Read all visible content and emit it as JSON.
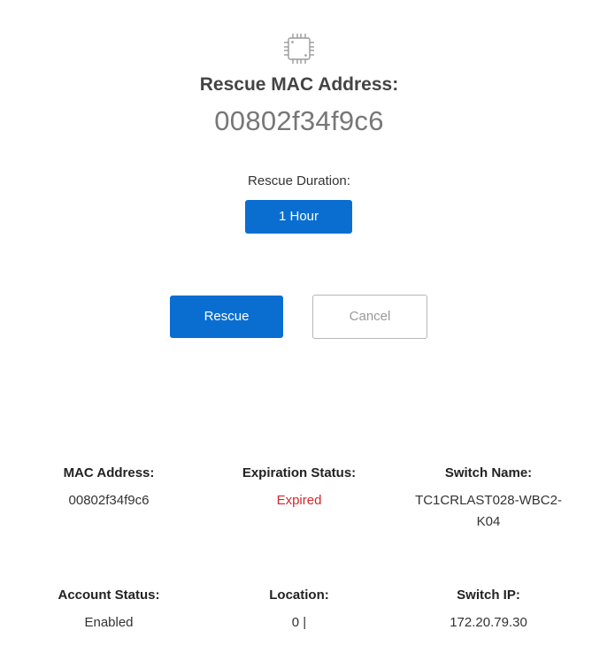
{
  "header": {
    "icon": "chip-icon",
    "title": "Rescue MAC Address:",
    "mac_address": "00802f34f9c6"
  },
  "duration": {
    "label": "Rescue Duration:",
    "selected": "1 Hour"
  },
  "actions": {
    "rescue_label": "Rescue",
    "cancel_label": "Cancel"
  },
  "info": {
    "mac_label": "MAC Address:",
    "mac_value": "00802f34f9c6",
    "expiration_label": "Expiration Status:",
    "expiration_value": "Expired",
    "switch_name_label": "Switch Name:",
    "switch_name_value": "TC1CRLAST028-WBC2-K04",
    "account_label": "Account Status:",
    "account_value": "Enabled",
    "location_label": "Location:",
    "location_value": "0 |",
    "switch_ip_label": "Switch IP:",
    "switch_ip_value": "172.20.79.30"
  },
  "colors": {
    "primary": "#0a6ed1",
    "expired": "#d0282e"
  }
}
